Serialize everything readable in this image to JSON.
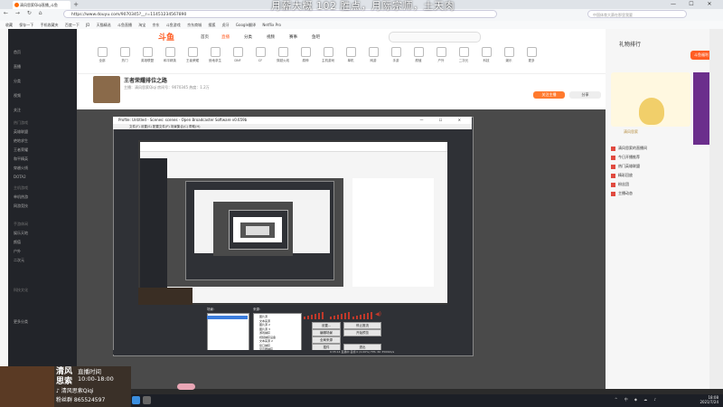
{
  "overlay_title": "月薪大概 102 胜点，月际宗师，土天肉",
  "browser": {
    "tab_title": "清风思索Qiqi直播_斗鱼",
    "new_tab": "+",
    "window_controls": [
      "—",
      "☐",
      "✕"
    ],
    "nav": "← → ↻ ⌂",
    "url": "https://www.douyu.com/9070345?__r=11451234567890",
    "search_placeholder": "中国体育大赛在那里我要",
    "bookmarks": [
      "收藏",
      "保存一下",
      "手机收藏夹",
      "百度一下",
      "JD",
      "天猫精选",
      "斗鱼直播",
      "淘宝",
      "京东",
      "斗鱼游戏",
      "京东商城",
      "搜狐",
      "虎牙",
      "Google翻译",
      "Netflix Pro"
    ]
  },
  "douyu": {
    "logo": "斗鱼",
    "menu": [
      "首页",
      "直播",
      "分类",
      "视频",
      "赛事",
      "鱼吧"
    ],
    "left_nav": [
      "首页",
      "直播",
      "分类",
      "视频",
      "关注",
      "热门游戏",
      "英雄联盟",
      "绝地求生",
      "王者荣耀",
      "和平精英",
      "穿越火线",
      "DOTA2",
      "主机游戏",
      "单机热游",
      "网游竞技",
      "手游休闲",
      "娱乐天地",
      "颜值",
      "户外",
      "二次元",
      "科技文化",
      "更多分类"
    ],
    "categories": [
      "全部",
      "热门",
      "英雄联盟",
      "和平精英",
      "王者荣耀",
      "绝地求生",
      "DNF",
      "CF",
      "穿越火线",
      "原神",
      "主机游戏",
      "单机",
      "网游",
      "手游",
      "颜值",
      "户外",
      "二次元",
      "科技",
      "娱乐",
      "更多"
    ],
    "room_title": "王者荣耀排位之路",
    "room_meta": "主播：清风思索Qiqi  房间号：9070345  热度：1.2万",
    "follow": "关注主播",
    "share": "分享"
  },
  "right_panel": {
    "header": "礼物排行",
    "card_text": "清风思索",
    "top_ad": "斗鱼福利",
    "list": [
      "清风思索的直播间",
      "今日开播推荐",
      "热门英雄联盟",
      "精彩回放",
      "粉丝团",
      "主播动态"
    ]
  },
  "obs": {
    "title": "Profile: Untitled - Scenes: scenes - Open Broadcaster Software v0.659b",
    "title_controls": "— ☐ ✕",
    "menu": "文件(F)  设置(S)  配置文件(P)  场景集合(C)  帮助(H)",
    "scenes_label": "场景：",
    "sources_label": "来源：",
    "sources": [
      "图片源",
      "文本来源",
      "图片源 2",
      "图片源 3",
      "游戏捕获",
      "视频捕获设备",
      "文本来源 2",
      "窗口捕获",
      "显示器捕获"
    ],
    "buttons": {
      "settings": "设置...",
      "stop_stream": "停止推流",
      "edit_scene": "编辑场景",
      "global_sources": "全局来源",
      "plugins": "插件",
      "start_preview": "开始预览",
      "exit": "退出"
    },
    "status": "0:35:14  直播中    丢帧 0 (0.00%)    FPS: 60    3500kb/s"
  },
  "streamer": {
    "name_line1": "清风",
    "name_line2": "思索",
    "live_time_label": "直播时间",
    "live_time": "10:00-18:00",
    "tiktok": "♪ 清风思索Qiqi",
    "fans": "粉丝群 865524597"
  },
  "taskbar": {
    "tray": "^ 中 ◆ ☁ ♪",
    "time": "18:08",
    "date": "2021/7/24"
  }
}
